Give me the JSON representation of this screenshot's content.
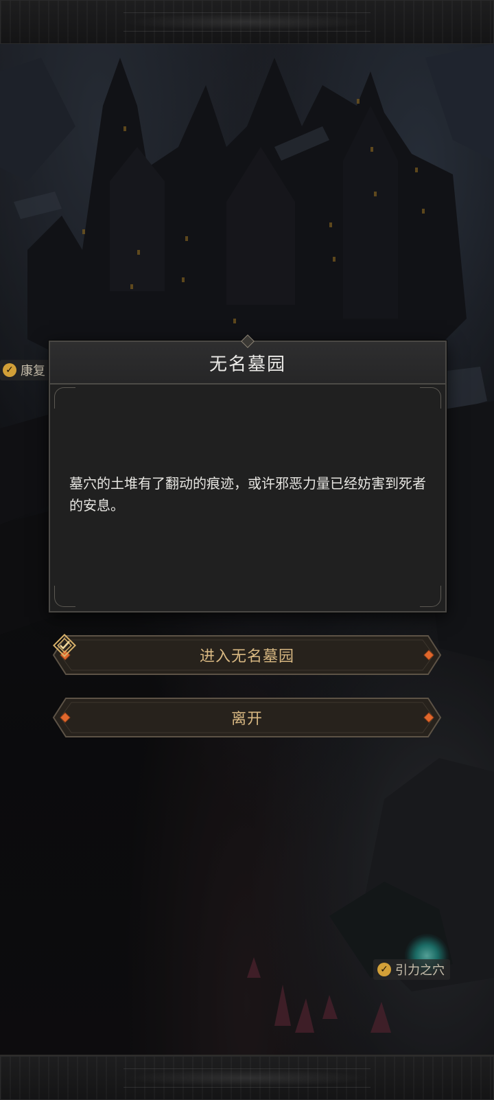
{
  "map_labels": {
    "left": "康复",
    "right": "引力之穴"
  },
  "dialog": {
    "title": "无名墓园",
    "body": "墓穴的土堆有了翻动的痕迹，或许邪恶力量已经妨害到死者的安息。"
  },
  "buttons": {
    "enter": "进入无名墓园",
    "leave": "离开"
  },
  "icons": {
    "check": "✓",
    "enter_icon": "diamond-check-icon"
  },
  "colors": {
    "button_text": "#d8b882",
    "badge_gold": "#d2a038",
    "gem_orange": "#e0672c",
    "portal_cyan": "#2aa59b"
  }
}
